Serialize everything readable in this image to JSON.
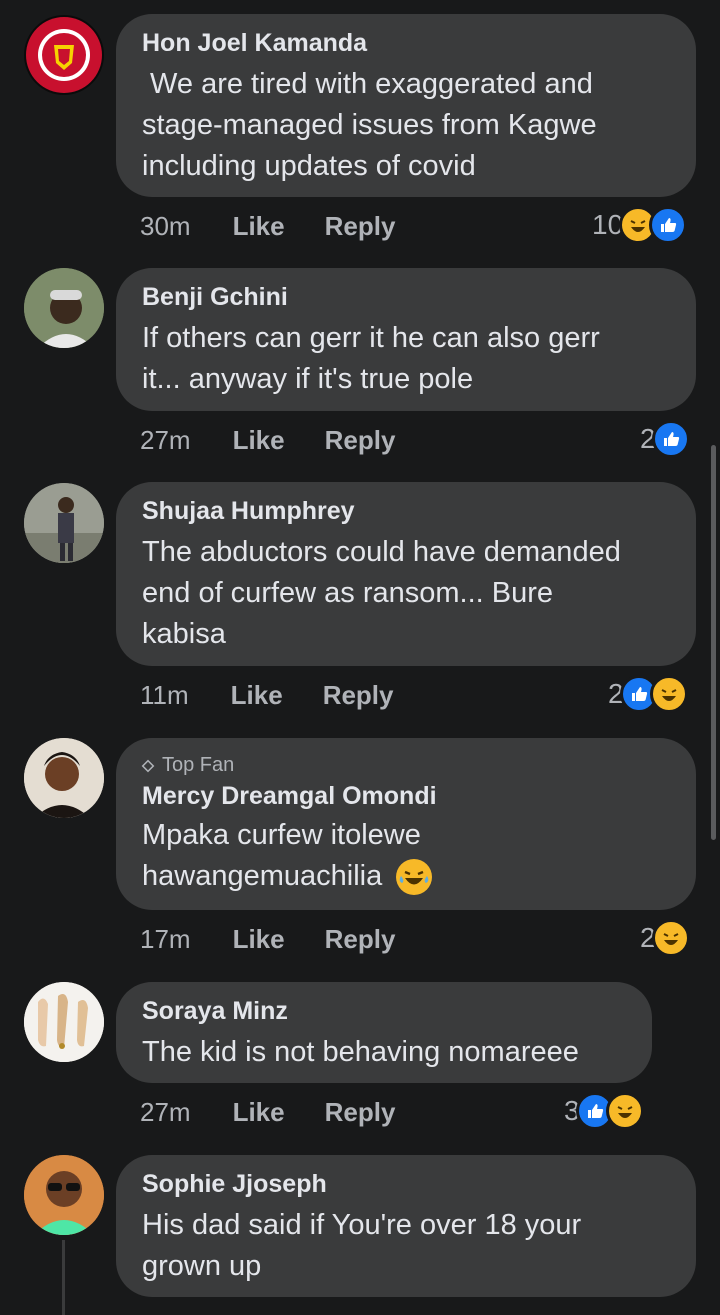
{
  "comments": [
    {
      "name": "Hon Joel Kamanda",
      "lines": [
        " We are tired with exaggerated and",
        "stage-managed issues from Kagwe",
        "including updates of covid"
      ],
      "time": "30m",
      "like": "Like",
      "reply": "Reply",
      "reaction_count": "10",
      "reactions": [
        "haha-icon",
        "like-icon"
      ]
    },
    {
      "name": "Benji Gchini",
      "lines": [
        "If others can gerr it he can also gerr",
        "it... anyway if it's true pole"
      ],
      "time": "27m",
      "like": "Like",
      "reply": "Reply",
      "reaction_count": "2",
      "reactions": [
        "like-icon"
      ]
    },
    {
      "name": "Shujaa Humphrey",
      "lines": [
        "The abductors could have demanded",
        "end of curfew as ransom... Bure",
        "kabisa"
      ],
      "time": "11m",
      "like": "Like",
      "reply": "Reply",
      "reaction_count": "2",
      "reactions": [
        "like-icon",
        "haha-icon"
      ]
    },
    {
      "badge": "Top Fan",
      "name": "Mercy Dreamgal Omondi",
      "lines": [
        "Mpaka curfew itolewe",
        "hawangemuachilia"
      ],
      "time": "17m",
      "like": "Like",
      "reply": "Reply",
      "reaction_count": "2",
      "reactions": [
        "haha-icon"
      ]
    },
    {
      "name": "Soraya Minz",
      "lines": [
        "The kid is not behaving nomareee"
      ],
      "time": "27m",
      "like": "Like",
      "reply": "Reply",
      "reaction_count": "3",
      "reactions": [
        "like-icon",
        "haha-icon"
      ]
    },
    {
      "name": "Sophie Jjoseph",
      "lines": [
        "His dad said if You're over 18 your",
        "grown up"
      ]
    }
  ],
  "colors": {
    "background": "#18191a",
    "bubble": "#3a3b3c",
    "like_blue": "#1877f2",
    "haha_yellow": "#f7b928",
    "secondary_text": "#b0b3b8"
  }
}
